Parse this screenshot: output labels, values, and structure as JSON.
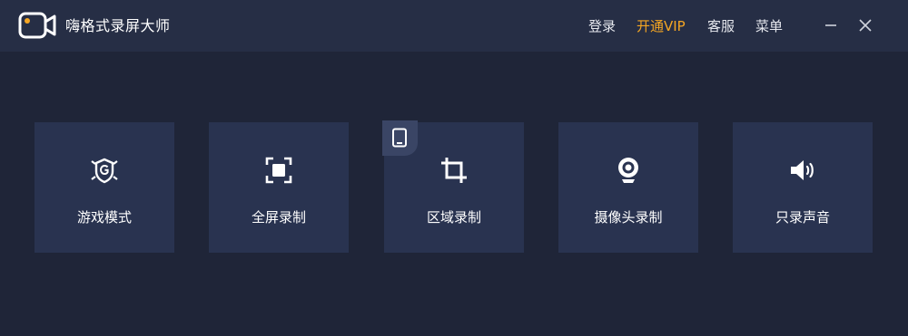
{
  "app": {
    "title": "嗨格式录屏大师"
  },
  "header": {
    "nav": [
      {
        "id": "login",
        "label": "登录"
      },
      {
        "id": "vip",
        "label": "开通VIP"
      },
      {
        "id": "service",
        "label": "客服"
      },
      {
        "id": "menu",
        "label": "菜单"
      }
    ],
    "window_controls": [
      "minimize-icon",
      "close-icon"
    ]
  },
  "modes": [
    {
      "id": "game",
      "label": "游戏模式",
      "icon": "game-shield-icon"
    },
    {
      "id": "fullscreen",
      "label": "全屏录制",
      "icon": "fullscreen-icon"
    },
    {
      "id": "region",
      "label": "区域录制",
      "icon": "crop-icon"
    },
    {
      "id": "camera",
      "label": "摄像头录制",
      "icon": "webcam-icon"
    },
    {
      "id": "audio",
      "label": "只录声音",
      "icon": "speaker-icon"
    }
  ],
  "region_badge": {
    "icon": "tablet-icon"
  },
  "colors": {
    "background": "#1f2538",
    "titlebar": "#262e45",
    "card": "#293350",
    "accent_vip": "#f5a623",
    "text": "#ffffff"
  }
}
